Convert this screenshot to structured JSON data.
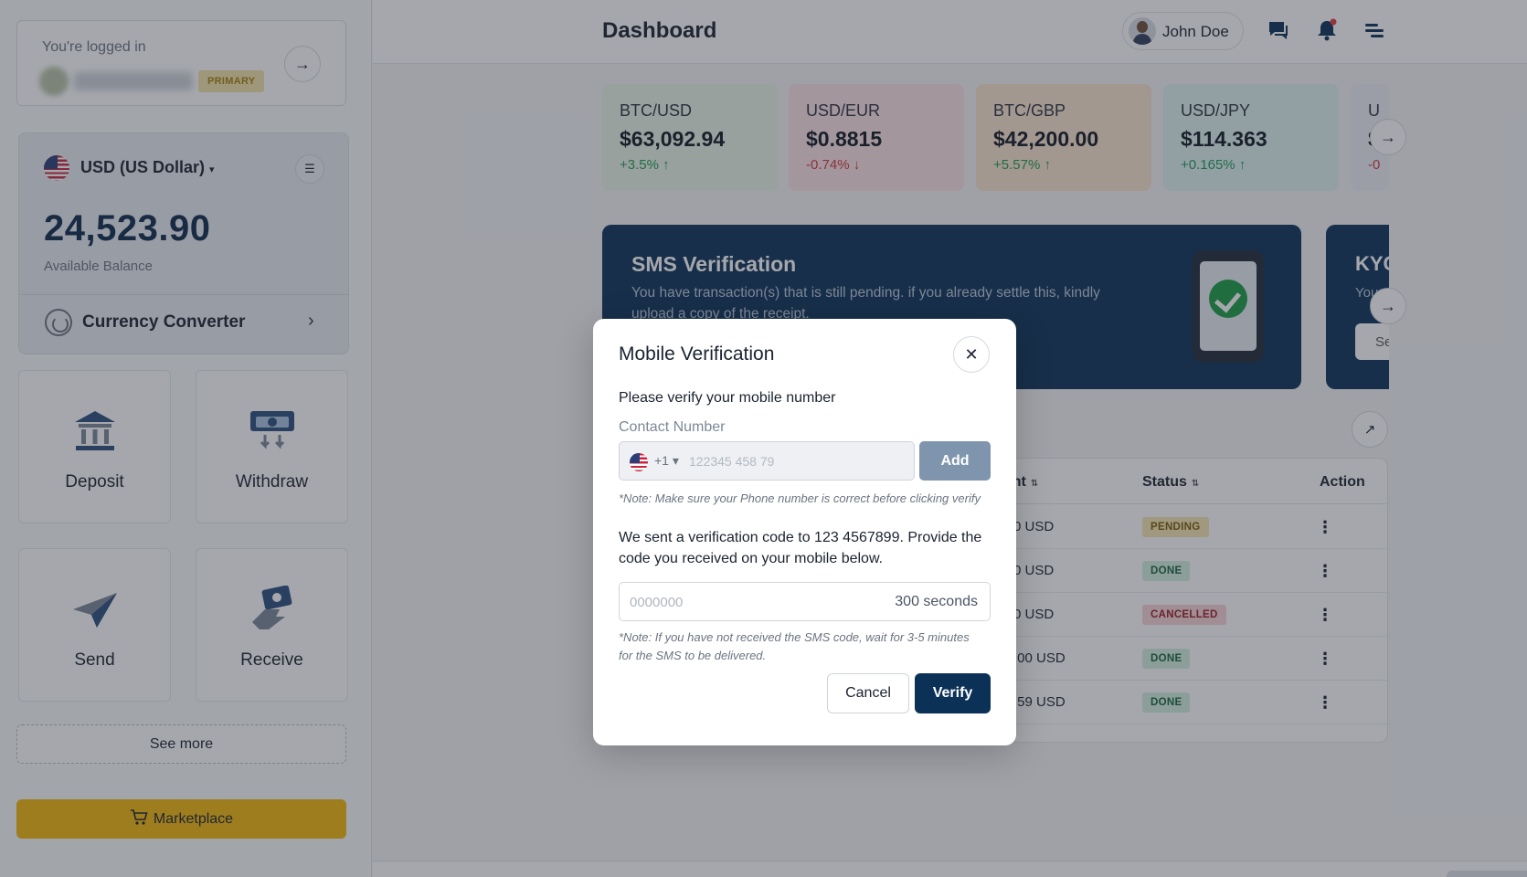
{
  "sidebar": {
    "login_label": "You're logged in",
    "primary_badge": "PRIMARY",
    "balance": {
      "currency": "USD (US Dollar)",
      "caret": "▾",
      "amount": "24,523.90",
      "available_label": "Available Balance",
      "converter_label": "Currency Converter"
    },
    "tiles": {
      "deposit": "Deposit",
      "withdraw": "Withdraw",
      "send": "Send",
      "receive": "Receive"
    },
    "see_more": "See more",
    "marketplace": "Marketplace"
  },
  "header": {
    "title": "Dashboard",
    "user_name": "John Doe"
  },
  "rates": [
    {
      "pair": "BTC/USD",
      "price": "$63,092.94",
      "change": "+3.5%",
      "arrow": "↑",
      "direction": "up"
    },
    {
      "pair": "USD/EUR",
      "price": "$0.8815",
      "change": "-0.74%",
      "arrow": "↓",
      "direction": "down"
    },
    {
      "pair": "BTC/GBP",
      "price": "$42,200.00",
      "change": "+5.57%",
      "arrow": "↑",
      "direction": "up"
    },
    {
      "pair": "USD/JPY",
      "price": "$114.363",
      "change": "+0.165%",
      "arrow": "↑",
      "direction": "up"
    },
    {
      "pair": "U",
      "price": "$",
      "change": "-0",
      "arrow": "",
      "direction": "down"
    }
  ],
  "sms_card": {
    "title": "SMS Verification",
    "text": "You have transaction(s) that is still pending. if you already settle this, kindly upload a copy of the receipt."
  },
  "kyc_card": {
    "title": "KYC",
    "text": "You",
    "button": "Se"
  },
  "table": {
    "headers": {
      "amount": "unt",
      "status": "Status",
      "action": "Action"
    },
    "sort_icon": "⇅",
    "action_icon": "⋮",
    "rows": [
      {
        "amount": "0 USD",
        "status": "PENDING",
        "type": "pending"
      },
      {
        "amount": "0 USD",
        "status": "DONE",
        "type": "done"
      },
      {
        "amount": "0 USD",
        "status": "CANCELLED",
        "type": "cancelled"
      },
      {
        "amount": ".00 USD",
        "status": "DONE",
        "type": "done"
      },
      {
        "amount": ".59 USD",
        "status": "DONE",
        "type": "done"
      }
    ]
  },
  "modal": {
    "title": "Mobile Verification",
    "close_glyph": "✕",
    "prompt": "Please verify your mobile number",
    "contact_label": "Contact Number",
    "country_code": "+1 ▾",
    "phone_placeholder": "122345 458 79",
    "add_button": "Add",
    "note_phone": "*Note: Make sure your Phone number is correct before clicking verify",
    "sent_message": "We sent a verification code to 123 4567899. Provide the code you received on your mobile below.",
    "code_placeholder": "0000000",
    "timer": "300 seconds",
    "note_sms": "*Note: If you have not received the SMS code, wait for 3-5 minutes for the SMS to be delivered.",
    "cancel_button": "Cancel",
    "verify_button": "Verify"
  },
  "icons": {
    "arrow_right": "→",
    "arrow_up_right": "↗",
    "chevron_right": "›",
    "list": "☰"
  },
  "colors": {
    "brand_navy": "#0c3157",
    "accent_yellow": "#f2b70a",
    "up": "#1d9a55",
    "down": "#d8363d"
  }
}
